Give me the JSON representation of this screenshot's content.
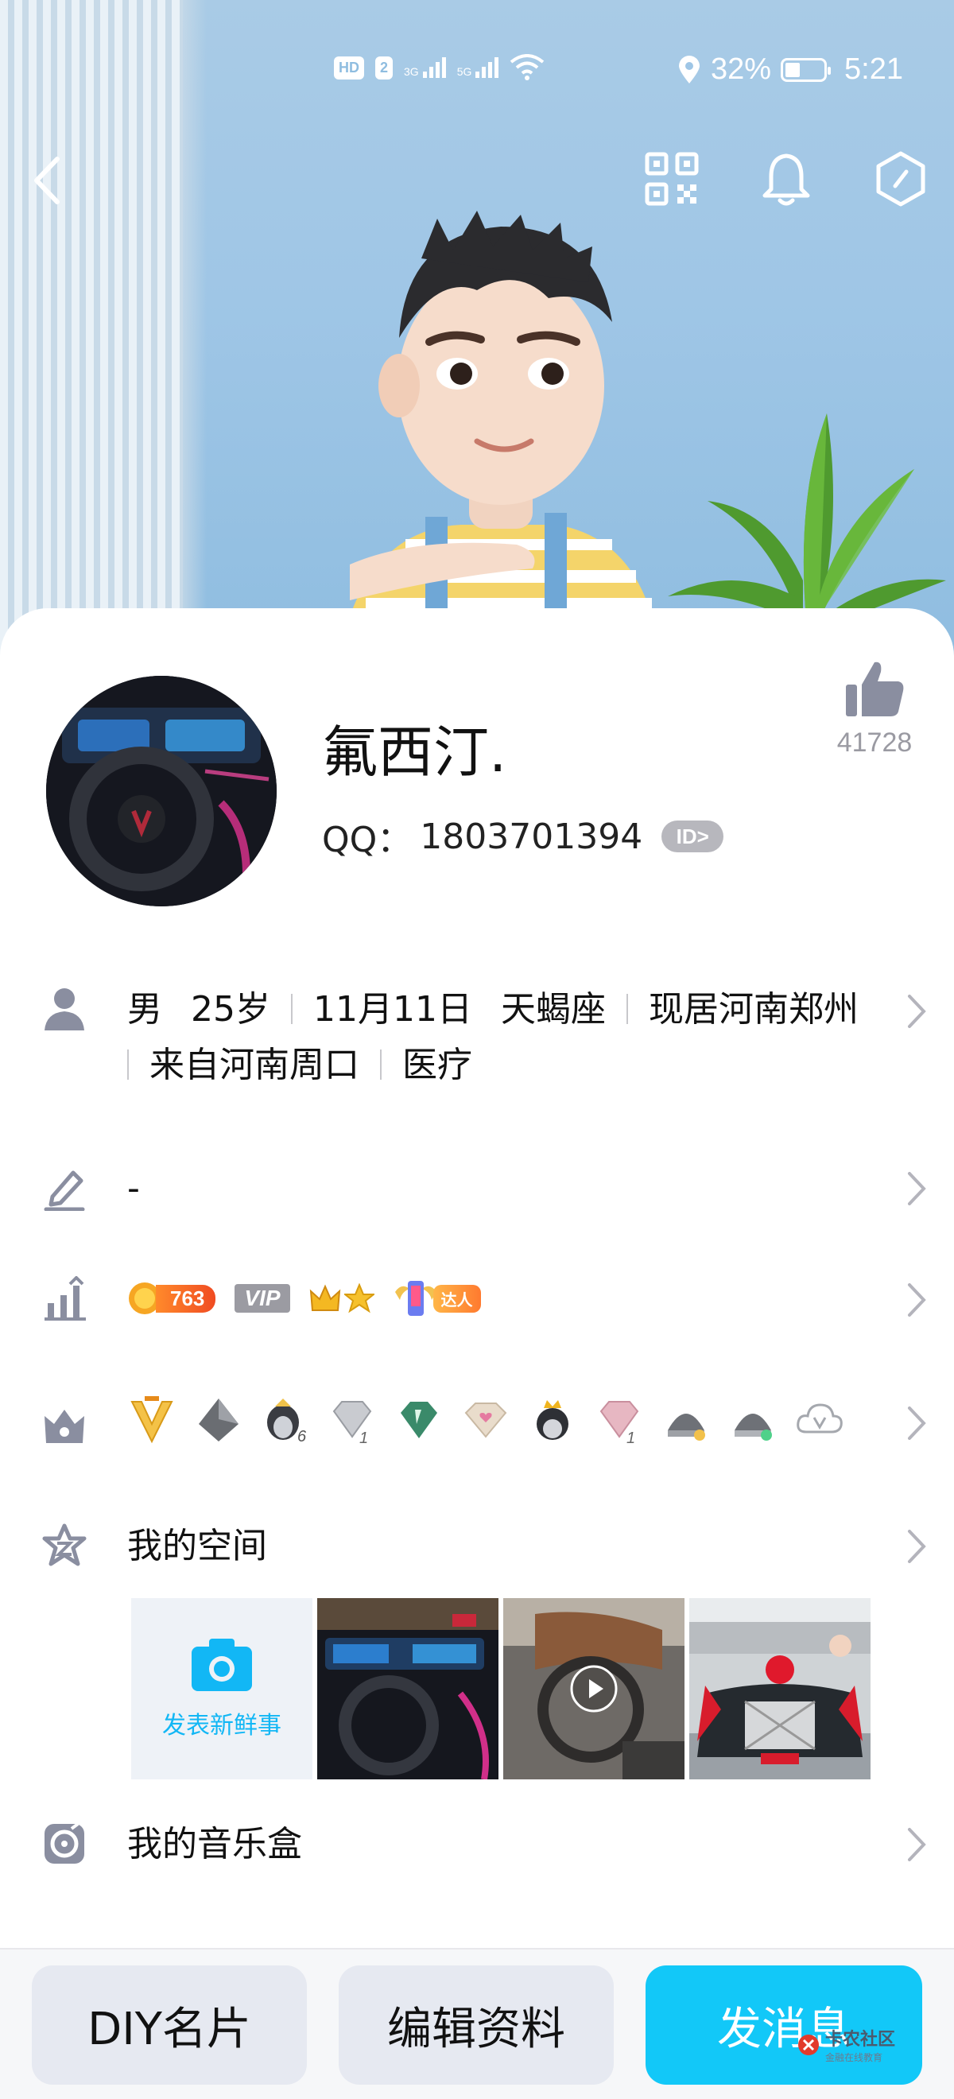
{
  "status_bar": {
    "network_chips": [
      "HD",
      "2"
    ],
    "signal_labels": [
      "3G",
      "5G"
    ],
    "battery": "32%",
    "time": "5:21"
  },
  "icons": {
    "back": "back-icon",
    "qr": "qr-code-icon",
    "bell": "bell-icon",
    "settings": "hexagon-settings-icon"
  },
  "profile": {
    "nickname": "氟西汀.",
    "qq_label": "QQ：",
    "qq_number": "1803701394",
    "id_badge": "ID>",
    "likes": "41728"
  },
  "info": {
    "gender": "男",
    "age": "25岁",
    "birthday": "11月11日",
    "zodiac": "天蝎座",
    "location": "现居河南郑州",
    "hometown": "来自河南周口",
    "profession": "医疗"
  },
  "signature": "-",
  "level_badges": {
    "level_number": "763",
    "vip": "VIP",
    "daren": "达人"
  },
  "my_space": {
    "title": "我的空间",
    "new_post_label": "发表新鲜事"
  },
  "music_box": {
    "title": "我的音乐盒"
  },
  "bottom": {
    "diy": "DIY名片",
    "edit": "编辑资料",
    "message": "发消息"
  },
  "watermark": {
    "title": "卡农社区",
    "subtitle": "金融在线教育"
  },
  "colors": {
    "accent": "#12c8f8",
    "icon_gray": "#8a8ea0",
    "badge_gray": "#b7b7bd"
  }
}
